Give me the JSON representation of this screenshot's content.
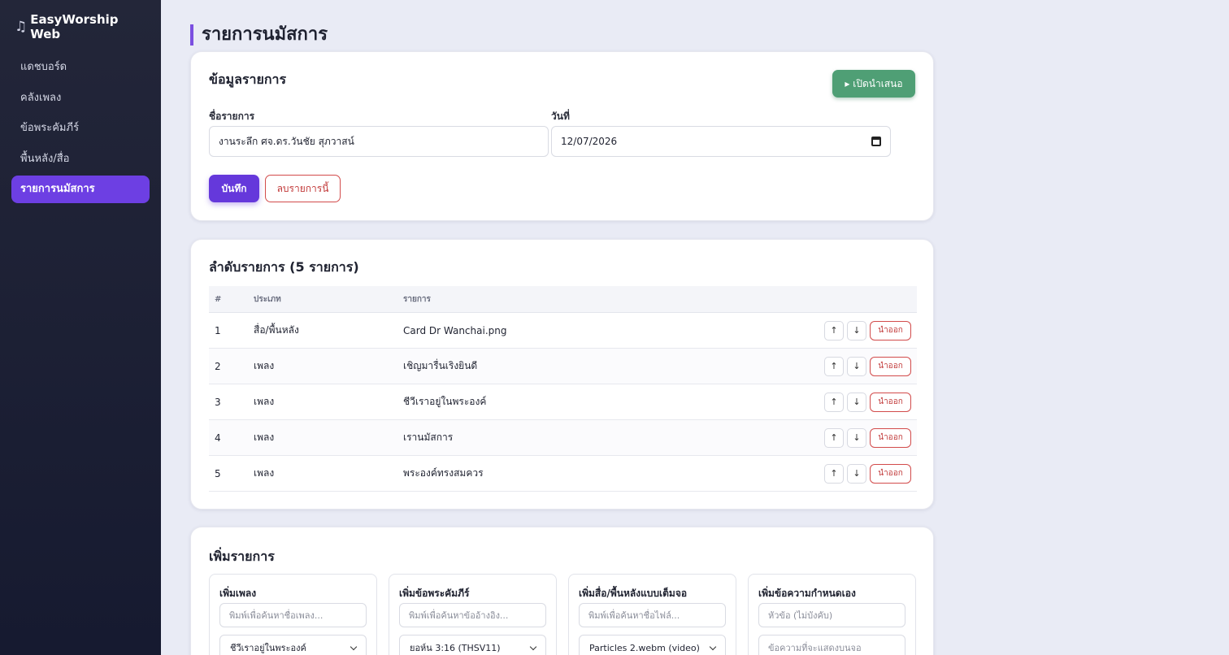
{
  "app": {
    "title": "EasyWorship Web",
    "logo_icon": "music-note-icon"
  },
  "sidebar": {
    "items": [
      {
        "label": "แดชบอร์ด",
        "active": false
      },
      {
        "label": "คลังเพลง",
        "active": false
      },
      {
        "label": "ข้อพระคัมภีร์",
        "active": false
      },
      {
        "label": "พื้นหลัง/สื่อ",
        "active": false
      },
      {
        "label": "รายการนมัสการ",
        "active": true
      }
    ]
  },
  "page": {
    "title": "รายการนมัสการ"
  },
  "info_card": {
    "title": "ข้อมูลรายการ",
    "present_label": "▸ เปิดนำเสนอ",
    "name_label": "ชื่อรายการ",
    "name_value": "งานระลึก ศจ.ดร.วันชัย สุภวาสน์",
    "date_label": "วันที่",
    "date_value": "12/07/2026",
    "save_label": "บันทึก",
    "delete_label": "ลบรายการนี้"
  },
  "order_card": {
    "title": "ลำดับรายการ (5 รายการ)",
    "columns": [
      "#",
      "ประเภท",
      "รายการ"
    ],
    "up_label": "↑",
    "down_label": "↓",
    "remove_label": "นำออก",
    "rows": [
      {
        "num": "1",
        "type": "สื่อ/พื้นหลัง",
        "item": "Card Dr Wanchai.png"
      },
      {
        "num": "2",
        "type": "เพลง",
        "item": "เชิญมารื่นเริงยินดี"
      },
      {
        "num": "3",
        "type": "เพลง",
        "item": "ชีวีเราอยู่ในพระองค์"
      },
      {
        "num": "4",
        "type": "เพลง",
        "item": "เรานมัสการ"
      },
      {
        "num": "5",
        "type": "เพลง",
        "item": "พระองค์ทรงสมควร"
      }
    ]
  },
  "add_card": {
    "title": "เพิ่มรายการ",
    "song": {
      "title": "เพิ่มเพลง",
      "placeholder": "พิมพ์เพื่อค้นหาชื่อเพลง...",
      "selected": "ชีวีเราอยู่ในพระองค์"
    },
    "scripture": {
      "title": "เพิ่มข้อพระคัมภีร์",
      "placeholder": "พิมพ์เพื่อค้นหาข้ออ้างอิง...",
      "selected": "ยอห์น 3:16 (THSV11)"
    },
    "media": {
      "title": "เพิ่มสื่อ/พื้นหลังแบบเต็มจอ",
      "placeholder": "พิมพ์เพื่อค้นหาชื่อไฟล์...",
      "selected": "Particles 2.webm (video)"
    },
    "custom": {
      "title": "เพิ่มข้อความกำหนดเอง",
      "heading_placeholder": "หัวข้อ (ไม่บังคับ)",
      "body_placeholder": "ข้อความที่จะแสดงบนจอ"
    }
  }
}
